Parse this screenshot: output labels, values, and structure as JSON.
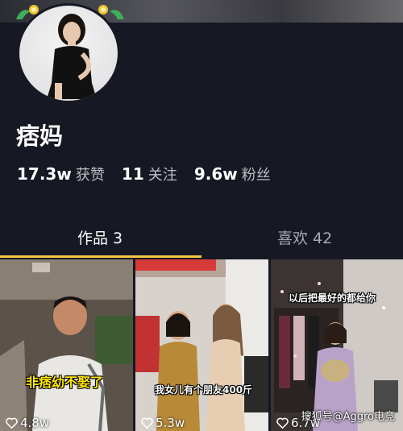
{
  "profile": {
    "name": "痞妈",
    "stats": [
      {
        "value": "17.3w",
        "label": "获赞"
      },
      {
        "value": "11",
        "label": "关注"
      },
      {
        "value": "9.6w",
        "label": "粉丝"
      }
    ]
  },
  "tabs": [
    {
      "label": "作品 3",
      "active": true
    },
    {
      "label": "喜欢 42",
      "active": false
    }
  ],
  "videos": [
    {
      "caption": "非痞幼不娶了",
      "likes": "4.8w"
    },
    {
      "caption": "我女儿有个朋友400斤",
      "likes": "5.3w"
    },
    {
      "caption": "以后把最好的都给你",
      "likes": "6.7w"
    }
  ],
  "watermark": "搜狐号@Aggro电竞",
  "colors": {
    "background": "#161823",
    "tab_indicator": "#f5c843",
    "caption_yellow": "#ffe600"
  }
}
